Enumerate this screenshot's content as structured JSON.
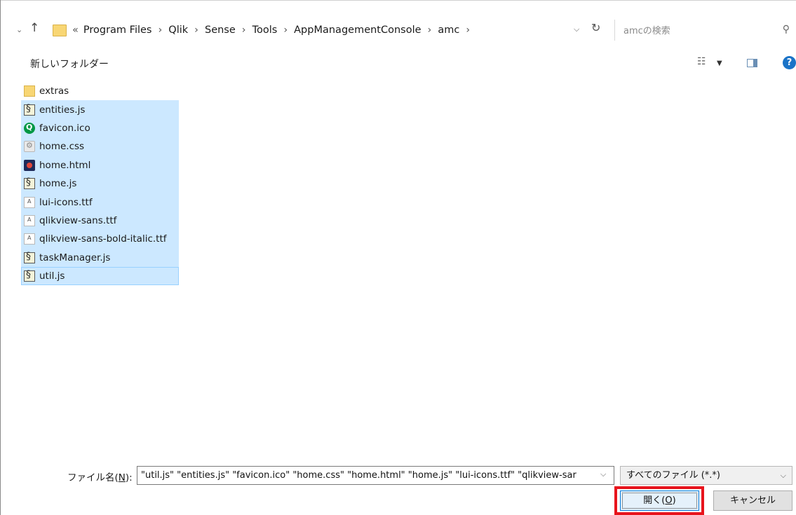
{
  "address_bar": {
    "prefix": "«",
    "crumbs": [
      "Program Files",
      "Qlik",
      "Sense",
      "Tools",
      "AppManagementConsole",
      "amc"
    ],
    "separator": "›"
  },
  "search": {
    "placeholder": "amcの検索"
  },
  "toolbar": {
    "new_folder_label": "新しいフォルダー",
    "view_icon": "view-options-icon",
    "help_icon": "help-icon",
    "help_glyph": "?"
  },
  "files": [
    {
      "name": "extras",
      "icon": "folder-icon",
      "selected": false
    },
    {
      "name": "entities.js",
      "icon": "js-script-icon",
      "selected": true
    },
    {
      "name": "favicon.ico",
      "icon": "qlik-icon",
      "selected": true
    },
    {
      "name": "home.css",
      "icon": "css-file-icon",
      "selected": true
    },
    {
      "name": "home.html",
      "icon": "html-file-icon",
      "selected": true
    },
    {
      "name": "home.js",
      "icon": "js-script-icon",
      "selected": true
    },
    {
      "name": "lui-icons.ttf",
      "icon": "font-file-icon",
      "selected": true
    },
    {
      "name": "qlikview-sans.ttf",
      "icon": "font-file-icon",
      "selected": true
    },
    {
      "name": "qlikview-sans-bold-italic.ttf",
      "icon": "font-file-icon",
      "selected": true
    },
    {
      "name": "taskManager.js",
      "icon": "js-script-icon",
      "selected": true
    },
    {
      "name": "util.js",
      "icon": "js-script-icon",
      "selected": true,
      "focused": true
    }
  ],
  "bottom": {
    "filename_label_prefix": "ファイル名(",
    "filename_label_key": "N",
    "filename_label_suffix": "):",
    "filename_value": "\"util.js\" \"entities.js\" \"favicon.ico\" \"home.css\" \"home.html\" \"home.js\" \"lui-icons.ttf\" \"qlikview-sar",
    "filetype_value": "すべてのファイル (*.*)",
    "open_label_prefix": "開く(",
    "open_label_key": "O",
    "open_label_suffix": ")",
    "cancel_label": "キャンセル"
  },
  "colors": {
    "selection": "#cce8ff",
    "highlight_box": "#e8141c",
    "accent": "#0078d7"
  }
}
